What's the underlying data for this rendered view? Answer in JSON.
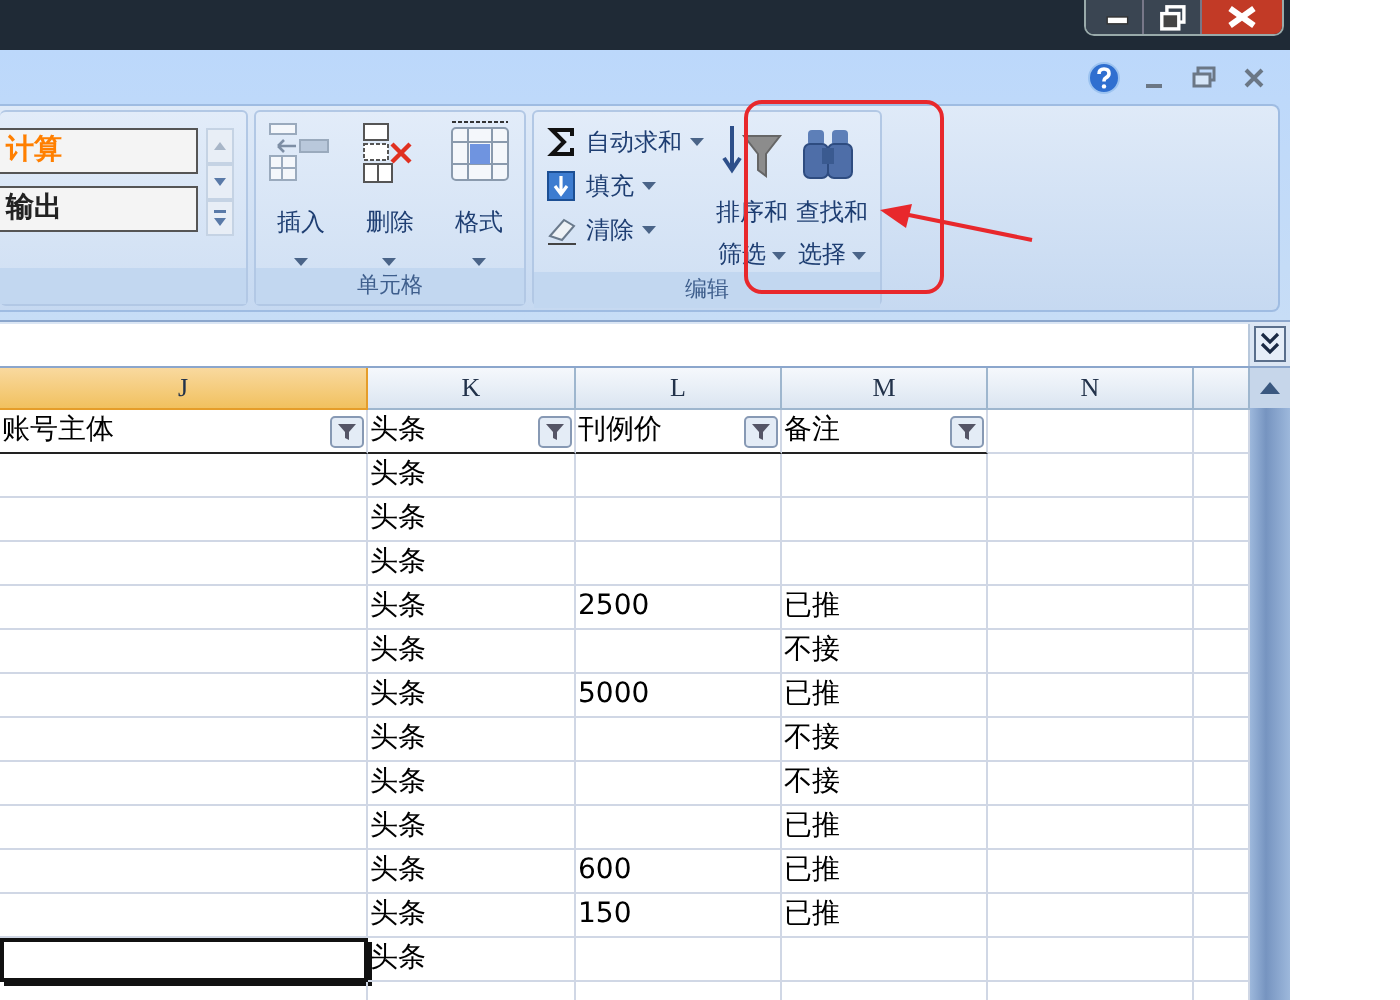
{
  "window": {
    "buttons": [
      {
        "kind": "minimize"
      },
      {
        "kind": "restore"
      },
      {
        "kind": "close"
      }
    ]
  },
  "workbook_controls": [
    {
      "kind": "help"
    },
    {
      "kind": "minimize"
    },
    {
      "kind": "restore"
    },
    {
      "kind": "close"
    }
  ],
  "ribbon": {
    "styles_group": {
      "items": [
        {
          "label": "计算",
          "color": "#ff7f00"
        },
        {
          "label": "输出",
          "color": "#222222"
        }
      ]
    },
    "cells_group": {
      "label": "单元格",
      "buttons": [
        {
          "label": "插入",
          "kind": "insert"
        },
        {
          "label": "删除",
          "kind": "delete"
        },
        {
          "label": "格式",
          "kind": "format"
        }
      ]
    },
    "editing_group": {
      "label": "编辑",
      "small_buttons": [
        {
          "label": "自动求和",
          "kind": "sum"
        },
        {
          "label": "填充",
          "kind": "fill"
        },
        {
          "label": "清除",
          "kind": "clear"
        }
      ],
      "large_buttons": [
        {
          "label": "排序和",
          "label_2": "筛选",
          "kind": "sort"
        },
        {
          "label": "查找和",
          "label_2": "选择",
          "kind": "find"
        }
      ]
    }
  },
  "annotation": {
    "highlight": true,
    "arrow": true
  },
  "sheet": {
    "columns": [
      {
        "label": "J",
        "selected": true
      },
      {
        "label": "K",
        "selected": false
      },
      {
        "label": "L",
        "selected": false
      },
      {
        "label": "M",
        "selected": false
      },
      {
        "label": "N",
        "selected": false
      }
    ],
    "header_row": [
      "账号主体",
      "头条",
      "刊例价",
      "备注"
    ],
    "rows": [
      {
        "cells": [
          "",
          "头条",
          "",
          ""
        ],
        "selected": false
      },
      {
        "cells": [
          "",
          "头条",
          "",
          ""
        ],
        "selected": false
      },
      {
        "cells": [
          "",
          "头条",
          "",
          ""
        ],
        "selected": false
      },
      {
        "cells": [
          "",
          "头条",
          "2500",
          "已推"
        ],
        "selected": false
      },
      {
        "cells": [
          "",
          "头条",
          "",
          "不接"
        ],
        "selected": false
      },
      {
        "cells": [
          "",
          "头条",
          "5000",
          "已推"
        ],
        "selected": false
      },
      {
        "cells": [
          "",
          "头条",
          "",
          "不接"
        ],
        "selected": false
      },
      {
        "cells": [
          "",
          "头条",
          "",
          "不接"
        ],
        "selected": false
      },
      {
        "cells": [
          "",
          "头条",
          "",
          "已推"
        ],
        "selected": false
      },
      {
        "cells": [
          "",
          "头条",
          "600",
          "已推"
        ],
        "selected": false
      },
      {
        "cells": [
          "",
          "头条",
          "150",
          "已推"
        ],
        "selected": false
      },
      {
        "cells": [
          "",
          "头条",
          "",
          ""
        ],
        "selected": true
      }
    ]
  }
}
